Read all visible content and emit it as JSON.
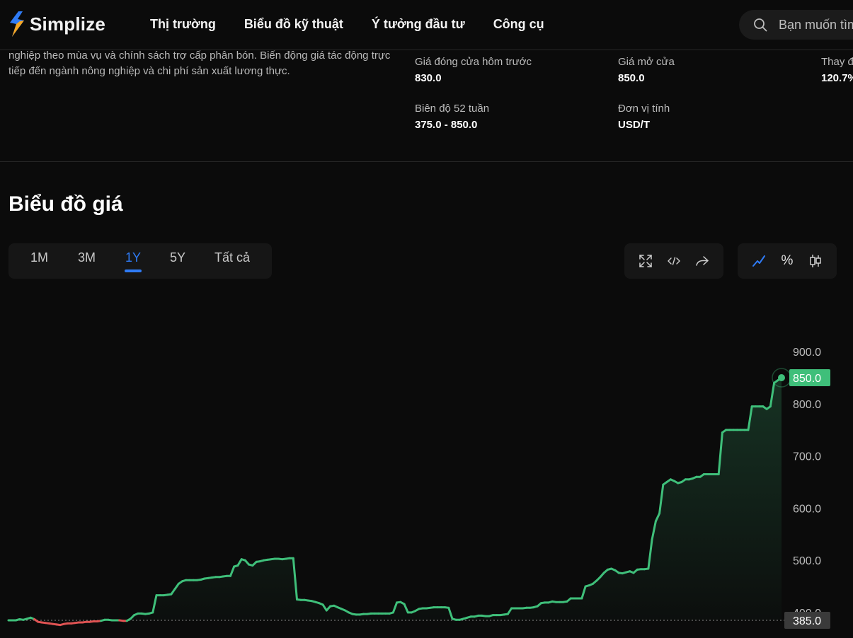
{
  "header": {
    "brand": "Simplize",
    "nav": [
      "Thị trường",
      "Biểu đồ kỹ thuật",
      "Ý tưởng đầu tư",
      "Công cụ"
    ],
    "search_placeholder": "Bạn muốn tìm"
  },
  "overview": {
    "description": "nghiệp theo mùa vụ và chính sách trợ cấp phân bón. Biến động giá tác động trực tiếp đến ngành nông nghiệp và chi phí sản xuất lương thực.",
    "stats": [
      {
        "label": "Giá đóng cửa hôm trước",
        "value": "830.0"
      },
      {
        "label": "Giá mở cửa",
        "value": "850.0"
      },
      {
        "label": "Thay đ",
        "value": "120.7%"
      },
      {
        "label": "Biên độ 52 tuần",
        "value": "375.0 - 850.0"
      },
      {
        "label": "Đơn vị tính",
        "value": "USD/T"
      }
    ]
  },
  "price_chart": {
    "title": "Biểu đồ giá",
    "ranges": [
      "1M",
      "3M",
      "1Y",
      "5Y",
      "Tất cả"
    ],
    "active_range": "1Y",
    "tools": [
      "expand-icon",
      "embed-code-icon",
      "share-icon"
    ],
    "chart_types": [
      "line-chart-icon",
      "percent-icon",
      "candlestick-icon"
    ],
    "active_chart_type": "line-chart-icon"
  },
  "colors": {
    "up": "#3fbf7a",
    "down": "#e05353",
    "accent": "#2f7bf5",
    "background": "#0b0b0b"
  },
  "chart_data": {
    "type": "line",
    "y_ticks": [
      400,
      500,
      600,
      700,
      800,
      900
    ],
    "ylim": [
      384,
      920
    ],
    "baseline": 385.0,
    "baseline_label": "385.0",
    "last_value": 850.0,
    "last_label": "850.0",
    "values": [
      385,
      385,
      385,
      387,
      386,
      388,
      390,
      387,
      382,
      381,
      380,
      379,
      378,
      377,
      376,
      378,
      379,
      379,
      380,
      381,
      381,
      382,
      382,
      383,
      383,
      384,
      386,
      386,
      385,
      385,
      385,
      384,
      384,
      388,
      395,
      398,
      398,
      397,
      398,
      400,
      433,
      433,
      433,
      434,
      435,
      445,
      455,
      460,
      462,
      462,
      462,
      462,
      463,
      465,
      466,
      467,
      468,
      468,
      469,
      470,
      470,
      488,
      490,
      502,
      500,
      492,
      490,
      497,
      498,
      500,
      501,
      502,
      503,
      503,
      502,
      503,
      504,
      504,
      425,
      424,
      424,
      423,
      422,
      420,
      418,
      415,
      404,
      412,
      413,
      410,
      407,
      404,
      400,
      397,
      396,
      396,
      397,
      397,
      398,
      398,
      398,
      398,
      398,
      398,
      400,
      419,
      420,
      416,
      400,
      400,
      403,
      407,
      408,
      408,
      409,
      410,
      410,
      410,
      410,
      409,
      388,
      386,
      386,
      388,
      390,
      392,
      392,
      394,
      394,
      393,
      393,
      395,
      395,
      395,
      396,
      397,
      408,
      408,
      408,
      408,
      409,
      409,
      410,
      412,
      418,
      419,
      419,
      421,
      420,
      420,
      420,
      421,
      427,
      427,
      427,
      427,
      450,
      452,
      455,
      461,
      468,
      476,
      482,
      484,
      481,
      476,
      475,
      477,
      479,
      476,
      482,
      483,
      483,
      484,
      540,
      575,
      590,
      645,
      650,
      655,
      652,
      648,
      650,
      655,
      655,
      657,
      660,
      660,
      665,
      665,
      665,
      665,
      665,
      745,
      750,
      750,
      750,
      750,
      750,
      750,
      750,
      795,
      795,
      795,
      795,
      790,
      795,
      840,
      845,
      850
    ]
  }
}
